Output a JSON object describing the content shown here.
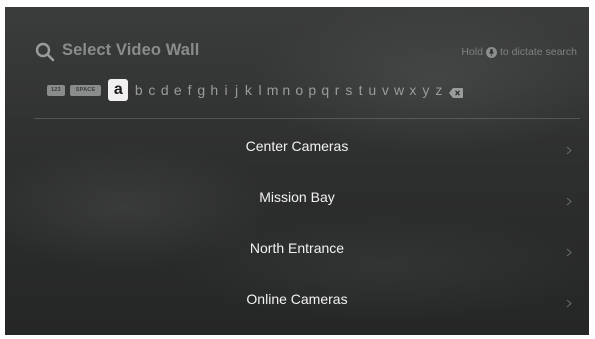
{
  "search": {
    "title": "Select Video Wall",
    "dictate_prefix": "Hold",
    "dictate_suffix": "to dictate search"
  },
  "keyboard": {
    "numbers_key": "123",
    "space_key": "SPACE",
    "letters": [
      "a",
      "b",
      "c",
      "d",
      "e",
      "f",
      "g",
      "h",
      "i",
      "j",
      "k",
      "l",
      "m",
      "n",
      "o",
      "p",
      "q",
      "r",
      "s",
      "t",
      "u",
      "v",
      "w",
      "x",
      "y",
      "z"
    ],
    "selected": "a",
    "delete_icon": "delete-backspace-icon"
  },
  "results": [
    {
      "label": "Center Cameras"
    },
    {
      "label": "Mission Bay"
    },
    {
      "label": "North Entrance"
    },
    {
      "label": "Online Cameras"
    }
  ],
  "colors": {
    "background": "#2d2e2e",
    "text_primary": "#f2f2f2",
    "text_muted": "#8a8b8b",
    "selected_key": "#f0f0f0"
  }
}
